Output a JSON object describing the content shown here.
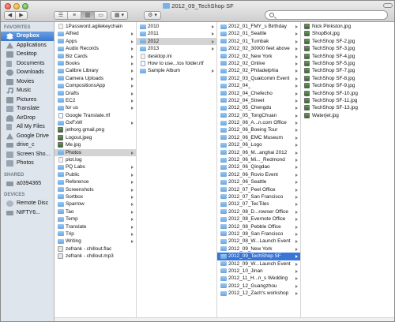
{
  "window": {
    "title": "2012_09_TechShop SF"
  },
  "toolbar": {
    "back": "◀",
    "forward": "▶",
    "view_buttons": [
      "☰",
      "≡",
      "▥",
      "▭"
    ],
    "arrange": "▦ ▾",
    "action": "⚙ ▾",
    "search": {
      "value": "",
      "placeholder": ""
    }
  },
  "sidebar": {
    "favorites_header": "FAVORITES",
    "favorites": [
      {
        "label": "Dropbox",
        "icon": "dropbox-icon"
      },
      {
        "label": "Applications",
        "icon": "applications-icon"
      },
      {
        "label": "Desktop",
        "icon": "desktop-icon"
      },
      {
        "label": "Documents",
        "icon": "documents-icon"
      },
      {
        "label": "Downloads",
        "icon": "downloads-icon"
      },
      {
        "label": "Movies",
        "icon": "movies-icon"
      },
      {
        "label": "Music",
        "icon": "music-icon"
      },
      {
        "label": "Pictures",
        "icon": "pictures-icon"
      },
      {
        "label": "Translate",
        "icon": "folder-icon"
      },
      {
        "label": "AirDrop",
        "icon": "airdrop-icon"
      },
      {
        "label": "All My Files",
        "icon": "all-files-icon"
      },
      {
        "label": "Google Drive",
        "icon": "google-drive-icon"
      },
      {
        "label": "drive_c",
        "icon": "drive-icon"
      },
      {
        "label": "Screen Sho...",
        "icon": "folder-icon"
      },
      {
        "label": "Photos",
        "icon": "folder-icon"
      }
    ],
    "shared_header": "SHARED",
    "shared": [
      {
        "label": "a0394365",
        "icon": "computer-icon"
      }
    ],
    "devices_header": "DEVICES",
    "devices": [
      {
        "label": "Remote Disc",
        "icon": "disc-icon"
      },
      {
        "label": "NIFTY6...",
        "icon": "disk-icon"
      }
    ]
  },
  "columns": [
    {
      "items": [
        {
          "label": "1Password.agilekeychain",
          "type": "file"
        },
        {
          "label": "Alfred",
          "type": "folder"
        },
        {
          "label": "Apps",
          "type": "folder"
        },
        {
          "label": "Audio Records",
          "type": "folder"
        },
        {
          "label": "Biz Cards",
          "type": "folder"
        },
        {
          "label": "Books",
          "type": "folder"
        },
        {
          "label": "Calibre Library",
          "type": "folder"
        },
        {
          "label": "Camera Uploads",
          "type": "folder"
        },
        {
          "label": "CompositionsApp",
          "type": "folder"
        },
        {
          "label": "Drafts",
          "type": "folder"
        },
        {
          "label": "EC2",
          "type": "folder"
        },
        {
          "label": "for us",
          "type": "folder"
        },
        {
          "label": "Google Translate.rtf",
          "type": "doc"
        },
        {
          "label": "GxFxW",
          "type": "folder"
        },
        {
          "label": "jethorg gmail.png",
          "type": "img"
        },
        {
          "label": "Logout.jpeg",
          "type": "img"
        },
        {
          "label": "Me.jpg",
          "type": "img"
        },
        {
          "label": "Photos",
          "type": "folder",
          "state": "gray"
        },
        {
          "label": "plot.log",
          "type": "file"
        },
        {
          "label": "PQ Labs",
          "type": "folder"
        },
        {
          "label": "Public",
          "type": "folder"
        },
        {
          "label": "Reference",
          "type": "folder"
        },
        {
          "label": "Screenshots",
          "type": "folder"
        },
        {
          "label": "Sortbox",
          "type": "folder"
        },
        {
          "label": "Sparrow",
          "type": "folder"
        },
        {
          "label": "Tao",
          "type": "folder"
        },
        {
          "label": "Temp",
          "type": "folder"
        },
        {
          "label": "Translate",
          "type": "folder"
        },
        {
          "label": "Trip",
          "type": "folder"
        },
        {
          "label": "Writing",
          "type": "folder"
        },
        {
          "label": "zefrank - chillout.flac",
          "type": "audio"
        },
        {
          "label": "zefrank - chillout.mp3",
          "type": "audio"
        }
      ]
    },
    {
      "items": [
        {
          "label": "2010",
          "type": "folder"
        },
        {
          "label": "2011",
          "type": "folder"
        },
        {
          "label": "2012",
          "type": "folder",
          "state": "gray"
        },
        {
          "label": "2013",
          "type": "folder"
        },
        {
          "label": "desktop.ini",
          "type": "file"
        },
        {
          "label": "How to use...tos folder.rtf",
          "type": "doc"
        },
        {
          "label": "Sample Album",
          "type": "folder"
        }
      ]
    },
    {
      "items": [
        {
          "label": "2012_01_FMY_s Birthday",
          "type": "folder"
        },
        {
          "label": "2012_01_Seattle",
          "type": "folder"
        },
        {
          "label": "2012_01_Tumbak",
          "type": "folder"
        },
        {
          "label": "2012_02_30000 feet above",
          "type": "folder"
        },
        {
          "label": "2012_02_New York",
          "type": "folder"
        },
        {
          "label": "2012_02_Onlive",
          "type": "folder"
        },
        {
          "label": "2012_02_Philadelphia",
          "type": "folder"
        },
        {
          "label": "2012_03_Qualcomm Event",
          "type": "folder"
        },
        {
          "label": "2012_04_",
          "type": "folder"
        },
        {
          "label": "2012_04_Chefecho",
          "type": "folder"
        },
        {
          "label": "2012_04_Street",
          "type": "folder"
        },
        {
          "label": "2012_05_Chengdu",
          "type": "folder"
        },
        {
          "label": "2012_05_TongChuan",
          "type": "folder"
        },
        {
          "label": "2012_06_A...n.com Office",
          "type": "folder"
        },
        {
          "label": "2012_06_Boeing Tour",
          "type": "folder"
        },
        {
          "label": "2012_06_EMC Museum",
          "type": "folder"
        },
        {
          "label": "2012_06_Logo",
          "type": "folder"
        },
        {
          "label": "2012_06_M...anghai 2012",
          "type": "folder"
        },
        {
          "label": "2012_06_Mi..._Redmond",
          "type": "folder"
        },
        {
          "label": "2012_06_Qingdao",
          "type": "folder"
        },
        {
          "label": "2012_06_Rovio Event",
          "type": "folder"
        },
        {
          "label": "2012_06_Seattle",
          "type": "folder"
        },
        {
          "label": "2012_07_Peel Office",
          "type": "folder"
        },
        {
          "label": "2012_07_San Francisco",
          "type": "folder"
        },
        {
          "label": "2012_07_TecTiles",
          "type": "folder"
        },
        {
          "label": "2012_08_D...rowser Office",
          "type": "folder"
        },
        {
          "label": "2012_08_Evernote Office",
          "type": "folder"
        },
        {
          "label": "2012_08_Pebble Office",
          "type": "folder"
        },
        {
          "label": "2012_08_San Francisco",
          "type": "folder"
        },
        {
          "label": "2012_08_W...Launch Event",
          "type": "folder"
        },
        {
          "label": "2012_09_New York",
          "type": "folder"
        },
        {
          "label": "2012_09_TechShop SF",
          "type": "folder",
          "state": "blue"
        },
        {
          "label": "2012_09_W...Launch Event",
          "type": "folder"
        },
        {
          "label": "2012_10_Jinan",
          "type": "folder"
        },
        {
          "label": "2012_11_H...n_s Wedding",
          "type": "folder"
        },
        {
          "label": "2012_12_Guangzhou",
          "type": "folder"
        },
        {
          "label": "2012_12_Zach's workshop",
          "type": "folder"
        }
      ]
    },
    {
      "items": [
        {
          "label": "Nick Pinkston.jpg",
          "type": "img"
        },
        {
          "label": "ShopBot.jpg",
          "type": "img"
        },
        {
          "label": "TechShop SF-2.jpg",
          "type": "img"
        },
        {
          "label": "TechShop SF-3.jpg",
          "type": "img"
        },
        {
          "label": "TechShop SF-4.jpg",
          "type": "img"
        },
        {
          "label": "TechShop SF-5.jpg",
          "type": "img"
        },
        {
          "label": "TechShop SF-7.jpg",
          "type": "img"
        },
        {
          "label": "TechShop SF-8.jpg",
          "type": "img"
        },
        {
          "label": "TechShop SF-9.jpg",
          "type": "img"
        },
        {
          "label": "TechShop SF-10.jpg",
          "type": "img"
        },
        {
          "label": "TechShop SF-11.jpg",
          "type": "img"
        },
        {
          "label": "TechShop SF-13.jpg",
          "type": "img"
        },
        {
          "label": "Waterjet.jpg",
          "type": "img"
        }
      ]
    }
  ]
}
